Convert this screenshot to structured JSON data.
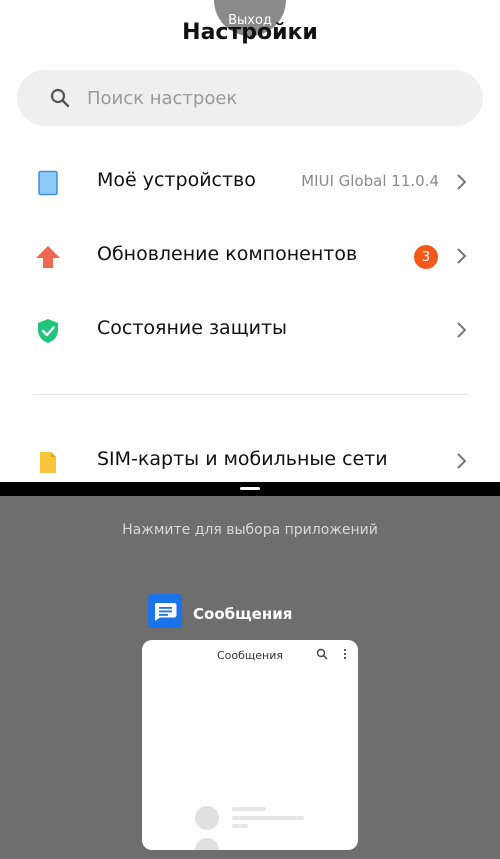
{
  "top": {
    "exit_label": "Выход",
    "title": "Настройки",
    "search": {
      "placeholder": "Поиск настроек"
    },
    "rows": [
      {
        "label": "Моё устройство",
        "value": "MIUI Global 11.0.4",
        "icon": "device-icon",
        "color": "#4aa3e6"
      },
      {
        "label": "Обновление компонентов",
        "badge": "3",
        "icon": "upload-arrow-icon",
        "color": "#f1664f"
      },
      {
        "label": "Состояние защиты",
        "icon": "shield-check-icon",
        "color": "#1ec57a"
      },
      {
        "label": "SIM-карты и мобильные сети",
        "icon": "sim-card-icon",
        "color": "#f8c43a"
      }
    ]
  },
  "bottom": {
    "hint": "Нажмите для выбора приложений",
    "app": {
      "name": "Сообщения",
      "icon": "messages-app-icon",
      "color": "#1a73e8"
    },
    "preview": {
      "title": "Сообщения"
    }
  }
}
